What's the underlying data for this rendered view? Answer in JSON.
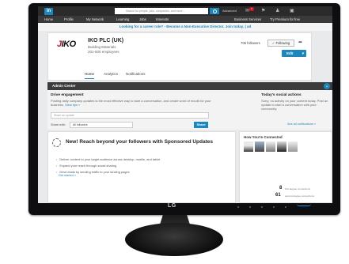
{
  "device": {
    "brand": "LG"
  },
  "topbar": {
    "logo": "in",
    "search_placeholder": "Search for people, jobs, companies, and more...",
    "advanced": "Advanced",
    "notifications_count": "2"
  },
  "nav": {
    "items": [
      "Home",
      "Profile",
      "My Network",
      "Learning",
      "Jobs",
      "Interests",
      "Business Services",
      "Try Premium for free"
    ]
  },
  "promo": {
    "text": "Looking for a career role? - Become a Non-Executive Director. Join today. | ad"
  },
  "company": {
    "logo_text_main": "IKO",
    "logo_text_j": "J",
    "name": "IKO PLC (UK)",
    "industry": "Building Materials",
    "size": "201-500 employees",
    "followers": "706 followers",
    "following_label": "✓ Following",
    "edit_label": "Edit",
    "tabs": [
      "Home",
      "Analytics",
      "Notifications"
    ]
  },
  "admin": {
    "title": "Admin Center",
    "engagement_title": "Drive engagement",
    "engagement_text": "Posting daily company updates is the most effective way to start a conversation, and create word of mouth for your business.",
    "engagement_link": "View tips »",
    "update_placeholder": "Share an update",
    "share_with_label": "Share with:",
    "share_with_value": "All followers",
    "share_button": "Share",
    "social_title": "Today's social actions",
    "social_text": "Sorry, no activity on your content today. Post an update to start a conversation with your community.",
    "see_all": "See all notifications »"
  },
  "sponsored": {
    "title": "New! Reach beyond your followers with Sponsored Updates",
    "bullets": [
      "Deliver content to your target audience across desktop, mobile, and tablet",
      "Expand your reach through social sharing",
      "Drive leads by sending traffic to your landing pages"
    ],
    "link": "Get started »"
  },
  "connected": {
    "title": "How You're Connected",
    "stat1_num": "8",
    "stat1_label": "first-degree connections",
    "stat2_num": "61",
    "stat2_label": "second-degree connections"
  }
}
